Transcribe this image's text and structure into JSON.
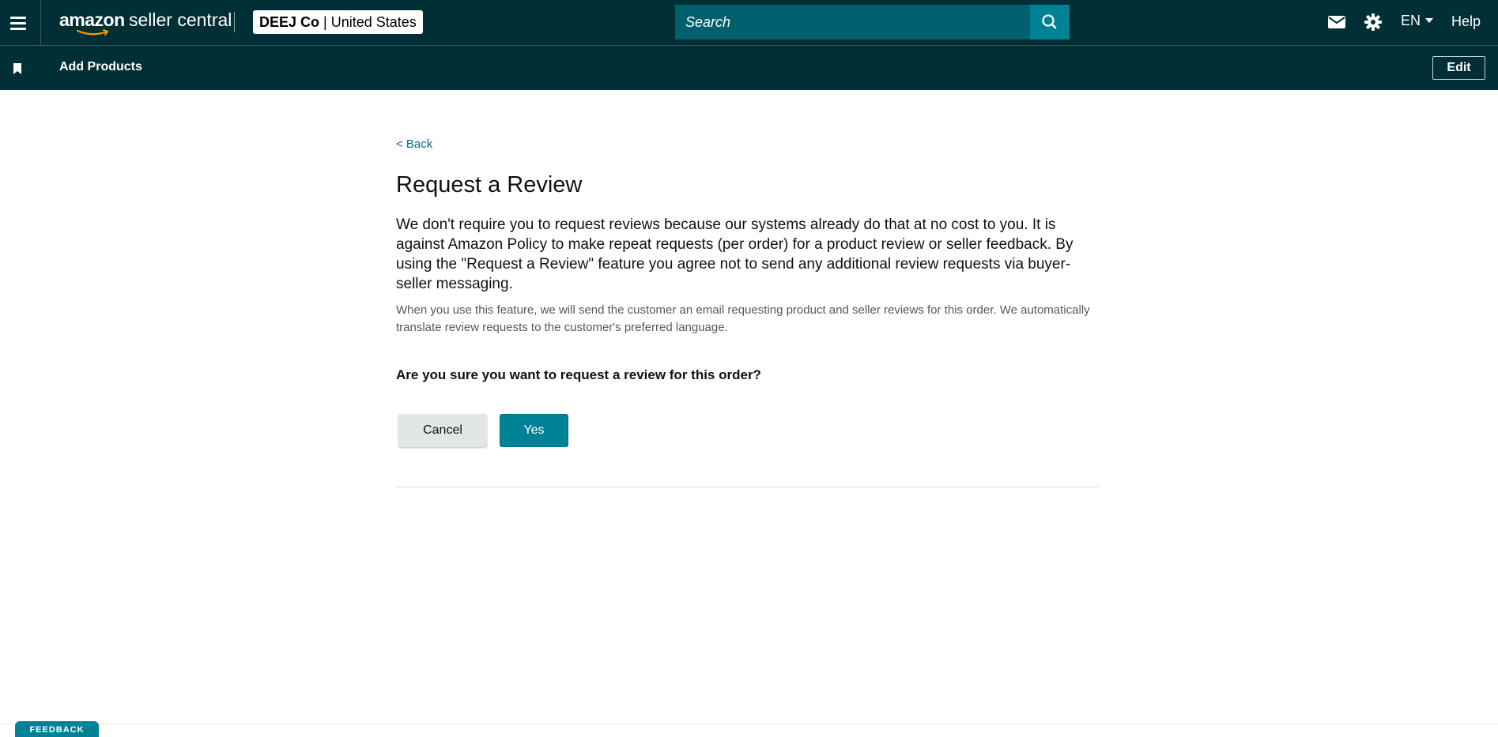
{
  "header": {
    "logo_text_bold": "amazon",
    "logo_text_light": "seller central",
    "account_name": "DEEJ Co",
    "account_separator": "|",
    "marketplace": "United States",
    "search_placeholder": "Search",
    "language": "EN",
    "help_label": "Help"
  },
  "subheader": {
    "bookmark_label": "Add Products",
    "edit_label": "Edit"
  },
  "main": {
    "back_link": "< Back",
    "title": "Request a Review",
    "lead_text": "We don't require you to request reviews because our systems already do that at no cost to you. It is against Amazon Policy to make repeat requests (per order) for a product review or seller feedback. By using the \"Request a Review\" feature you agree not to send any additional review requests via buyer-seller messaging.",
    "note_text": "When you use this feature, we will send the customer an email requesting product and seller reviews for this order. We automatically translate review requests to the customer's preferred language.",
    "question": "Are you sure you want to request a review for this order?",
    "cancel_label": "Cancel",
    "yes_label": "Yes"
  },
  "footer": {
    "feedback_label": "FEEDBACK"
  },
  "colors": {
    "header_bg": "#002f36",
    "search_bg": "#00606d",
    "accent_teal": "#008296",
    "link": "#007185"
  }
}
